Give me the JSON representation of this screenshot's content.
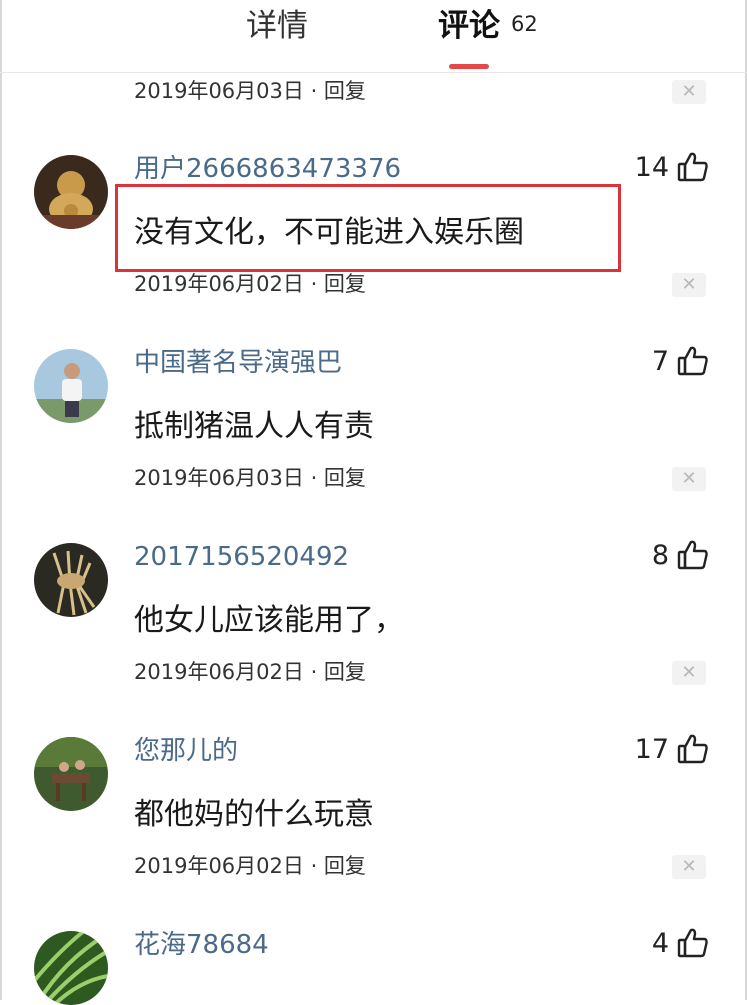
{
  "tabs": {
    "detail": "详情",
    "comments": "评论",
    "comments_count": "62"
  },
  "top_partial": {
    "date": "2019年06月03日",
    "reply": "· 回复"
  },
  "comments": [
    {
      "username": "用户2666863473376",
      "likes": "14",
      "text": "没有文化，不可能进入娱乐圈",
      "date": "2019年06月02日",
      "reply": "· 回复",
      "highlighted": true
    },
    {
      "username": "中国著名导演强巴",
      "likes": "7",
      "text": "抵制猪温人人有责",
      "date": "2019年06月03日",
      "reply": "· 回复"
    },
    {
      "username": "2017156520492",
      "likes": "8",
      "text": "他女儿应该能用了，",
      "date": "2019年06月02日",
      "reply": "· 回复"
    },
    {
      "username": "您那儿的",
      "likes": "17",
      "text": "都他妈的什么玩意",
      "date": "2019年06月02日",
      "reply": "· 回复"
    },
    {
      "username": "花海78684",
      "likes": "4"
    }
  ],
  "icons": {
    "like": "thumbs-up-icon",
    "close": "close-icon"
  },
  "colors": {
    "accent": "#e24a4a",
    "username": "#4a6a8a",
    "highlight": "#d8343a"
  }
}
